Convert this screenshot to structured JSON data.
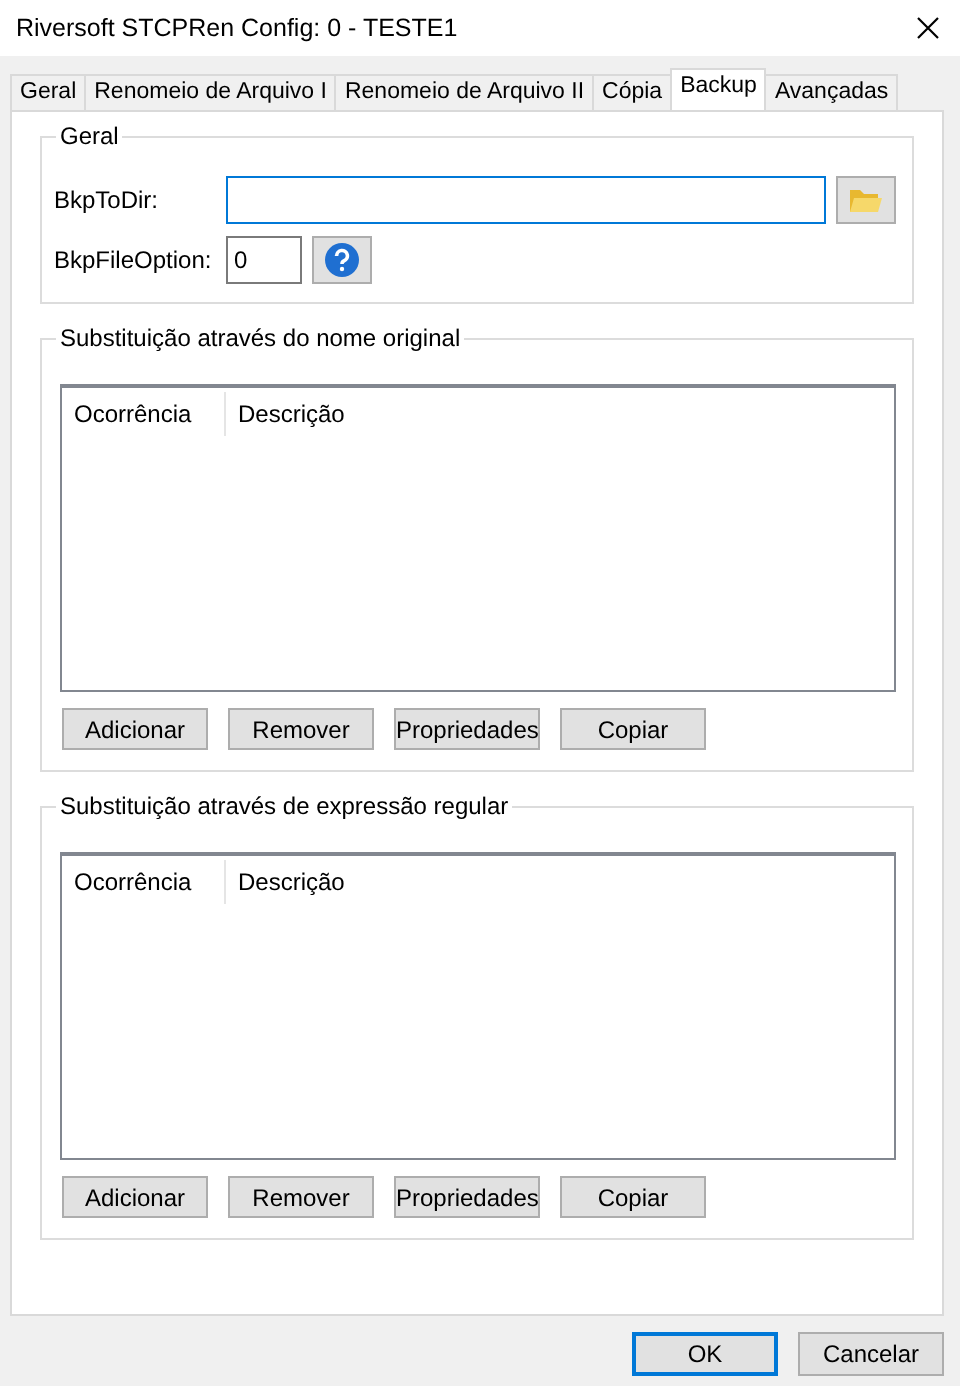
{
  "window": {
    "title": "Riversoft STCPRen Config: 0 - TESTE1"
  },
  "tabs": [
    {
      "label": "Geral",
      "selected": false
    },
    {
      "label": "Renomeio de Arquivo I",
      "selected": false
    },
    {
      "label": "Renomeio de Arquivo II",
      "selected": false
    },
    {
      "label": "Cópia",
      "selected": false
    },
    {
      "label": "Backup",
      "selected": true
    },
    {
      "label": "Avançadas",
      "selected": false
    }
  ],
  "general": {
    "title": "Geral",
    "fields": [
      {
        "kind": "folder",
        "label": "BkpToDir:",
        "focused": true
      },
      {
        "kind": "help",
        "label": "BkpFileOption:",
        "value": "0",
        "focused": false
      }
    ]
  },
  "rule_groups": [
    {
      "title": "Substituição através do nome original",
      "columns": [
        "Ocorrência",
        "Descrição"
      ],
      "buttons": [
        "Adicionar",
        "Remover",
        "Propriedades",
        "Copiar"
      ]
    },
    {
      "title": "Substituição através de expressão regular",
      "columns": [
        "Ocorrência",
        "Descrição"
      ],
      "buttons": [
        "Adicionar",
        "Remover",
        "Propriedades",
        "Copiar"
      ]
    }
  ],
  "dialog_buttons": [
    {
      "label": "OK",
      "default": true
    },
    {
      "label": "Cancelar",
      "default": false
    }
  ]
}
